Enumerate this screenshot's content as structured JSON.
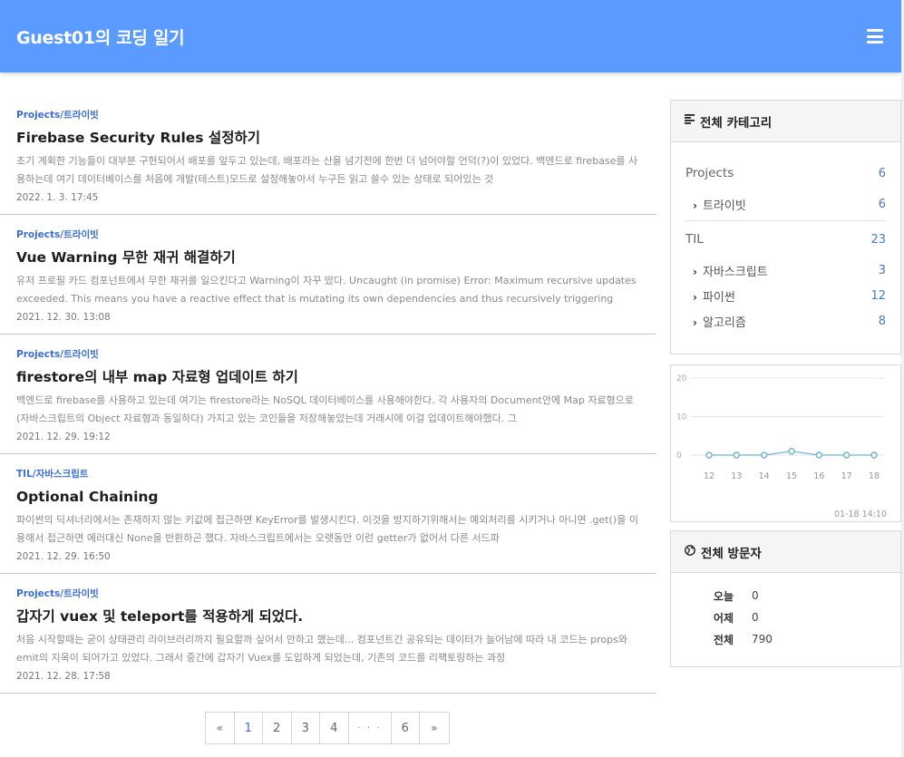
{
  "header": {
    "title": "Guest01의 코딩 일기",
    "menu_icon": "hamburger-menu-icon",
    "bg_color": "#5b9bff"
  },
  "posts": [
    {
      "category": "Projects/트라이빗",
      "title": "Firebase Security Rules 설정하기",
      "excerpt": "초기 계획한 기능들이 대부분 구현되어서 배포를 앞두고 있는데, 배포라는 산을 넘기전에 한번 더 넘어야할 언덕(?)이 있었다. 백엔드로 firebase를 사용하는데 여기 데이터베이스를 처음에 개발(테스트)모드로 설정해놓아서 누구든 읽고 쓸수 있는 상태로 되어있는 것",
      "date": "2022. 1. 3. 17:45"
    },
    {
      "category": "Projects/트라이빗",
      "title": "Vue Warning 무한 재귀 해결하기",
      "excerpt": "유저 프로필 카드 컴포넌트에서 무한 재귀를 일으킨다고 Warning이 자꾸 떴다. Uncaught (in promise) Error: Maximum recursive updates exceeded. This means you have a reactive effect that is mutating its own dependencies and thus recursively triggering",
      "date": "2021. 12. 30. 13:08"
    },
    {
      "category": "Projects/트라이빗",
      "title": "firestore의 내부 map 자료형 업데이트 하기",
      "excerpt": "백엔드로 firebase를 사용하고 있는데 여기는 firestore라는 NoSQL 데이터베이스를 사용해야한다. 각 사용자의 Document안에 Map 자료형으로(자바스크립트의 Object 자료형과 동일하다) 가지고 있는 코인들을 저장해놓았는데 거래시에 이걸 업데이트해야했다. 그",
      "date": "2021. 12. 29. 19:12"
    },
    {
      "category": "TIL/자바스크립트",
      "title": "Optional Chaining",
      "excerpt": "파이썬의 딕셔너리에서는 존재하지 않는 키값에 접근하면 KeyError를 발생시킨다. 이것을 방지하기위해서는 예외처리를 시키거나 아니면 .get()을 이용해서 접근하면 에러대신 None을 반환하곤 했다. 자바스크립트에서는 오랫동안 이런 getter가 없어서 다른 서드파",
      "date": "2021. 12. 29. 16:50"
    },
    {
      "category": "Projects/트라이빗",
      "title": "갑자기 vuex 및 teleport를 적용하게 되었다.",
      "excerpt": "처음 시작할때는 굳이 상태관리 라이브러리까지 필요할까 싶어서 안하고 했는데... 컴포넌트간 공유되는 데이터가 늘어남에 따라 내 코드는 props와 emit의 지옥이 되어가고 있었다. 그래서 중간에 갑자기 Vuex를 도입하게 되었는데, 기존의 코드를 리팩토링하는 과정",
      "date": "2021. 12. 28. 17:58"
    }
  ],
  "pagination": {
    "prev": "«",
    "pages": [
      "1",
      "2",
      "3",
      "4"
    ],
    "ellipsis": "· · ·",
    "last": "6",
    "next": "»",
    "active": "1"
  },
  "categories": {
    "title": "전체 카테고리",
    "icon": "list-icon",
    "groups": [
      {
        "name": "Projects",
        "count": "6",
        "subs": [
          {
            "name": "트라이빗",
            "count": "6"
          }
        ]
      },
      {
        "name": "TIL",
        "count": "23",
        "subs": [
          {
            "name": "자바스크립트",
            "count": "3"
          },
          {
            "name": "파이썬",
            "count": "12"
          },
          {
            "name": "알고리즘",
            "count": "8"
          }
        ]
      }
    ]
  },
  "chart_data": {
    "type": "line",
    "x": [
      "12",
      "13",
      "14",
      "15",
      "16",
      "17",
      "18"
    ],
    "values": [
      0,
      0,
      0,
      1,
      0,
      0,
      0
    ],
    "yticks": [
      "20",
      "10",
      "0"
    ],
    "ylim": [
      0,
      20
    ],
    "timestamp": "01-18 14:10",
    "line_color": "#6fb4d9"
  },
  "visitors": {
    "title": "전체 방문자",
    "icon": "globe-icon",
    "rows": [
      {
        "label": "오늘",
        "value": "0"
      },
      {
        "label": "어제",
        "value": "0"
      },
      {
        "label": "전체",
        "value": "790"
      }
    ]
  }
}
